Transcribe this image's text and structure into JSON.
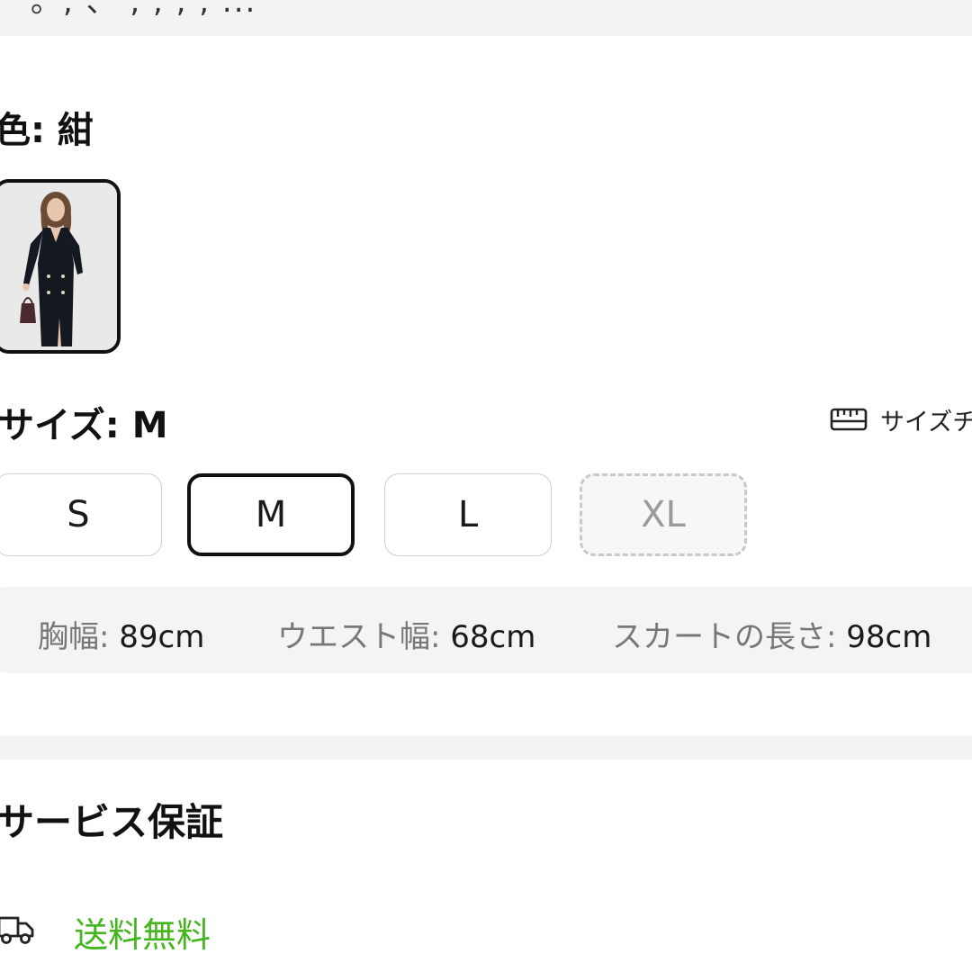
{
  "top": {
    "partial_text": "。, 、 ,  ,  ,  ,  ..."
  },
  "color_section": {
    "label": "色: 紺",
    "swatches": [
      {
        "name": "紺",
        "selected": true
      }
    ]
  },
  "size_section": {
    "label": "サイズ: M",
    "size_chart_link": "サイズチ",
    "options": [
      {
        "label": "S",
        "state": "normal"
      },
      {
        "label": "M",
        "state": "selected"
      },
      {
        "label": "L",
        "state": "normal"
      },
      {
        "label": "XL",
        "state": "disabled"
      }
    ],
    "measurements": [
      {
        "label": "胸幅:",
        "value": "89cm"
      },
      {
        "label": "ウエスト幅:",
        "value": "68cm"
      },
      {
        "label": "スカートの長さ:",
        "value": "98cm"
      }
    ]
  },
  "service_section": {
    "title": "サービス保証",
    "items": [
      {
        "icon": "truck-icon",
        "label": "送料無料"
      }
    ]
  },
  "colors": {
    "accent_green": "#45b51f",
    "selected_border": "#111111",
    "disabled_text": "#9b9b9b"
  }
}
